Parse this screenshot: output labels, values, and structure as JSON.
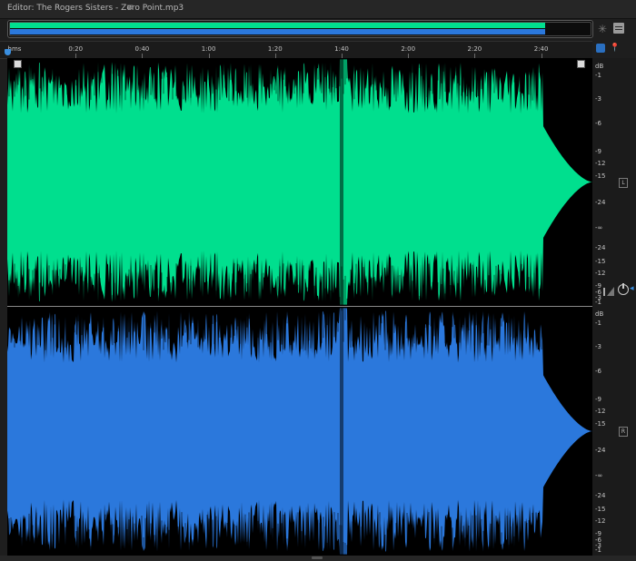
{
  "window": {
    "title": "Editor: The Rogers Sisters - Zero Point.mp3",
    "menu_icon": "hamburger-icon",
    "toolbar_icons": [
      "zoom-navigator-icon",
      "panel-menu-icon"
    ]
  },
  "ruler": {
    "unit_label": "hms",
    "ticks": [
      "0:20",
      "0:40",
      "1:00",
      "1:20",
      "1:40",
      "2:00",
      "2:20",
      "2:40"
    ]
  },
  "channels": [
    {
      "id": "L",
      "badge": "L",
      "color": "#00df8e",
      "db_scale": [
        "dB",
        "-1",
        "-3",
        "-6",
        "-9",
        "-12",
        "-15",
        "-24",
        "-∞",
        "-24",
        "-15",
        "-12",
        "-9",
        "-6",
        "-3",
        "-1"
      ]
    },
    {
      "id": "R",
      "badge": "R",
      "color": "#2b78dc",
      "db_scale": [
        "dB",
        "-1",
        "-3",
        "-6",
        "-9",
        "-12",
        "-15",
        "-24",
        "-∞",
        "-24",
        "-15",
        "-12",
        "-9",
        "-6",
        "-3",
        "-1"
      ]
    }
  ],
  "colors": {
    "left_channel": "#00df8e",
    "right_channel": "#2b78dc",
    "waveform_bg": "#000000",
    "playhead": "#3a8fe0"
  },
  "icons": {
    "snap": "snap-magnet-icon",
    "pin": "pin-icon",
    "amplitude": "amplitude-level-icon",
    "power": "power-icon",
    "playhead": "playhead-marker-icon"
  }
}
